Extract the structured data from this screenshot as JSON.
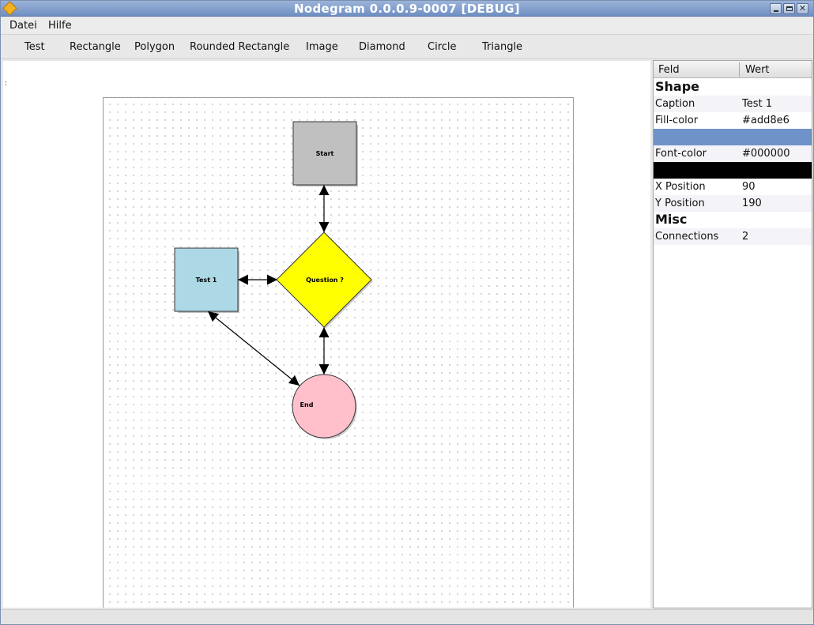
{
  "window": {
    "title": "Nodegram 0.0.0.9-0007 [DEBUG]",
    "close_glyph": "✕"
  },
  "menu": {
    "items": [
      "Datei",
      "Hilfe"
    ]
  },
  "toolbar": {
    "items": [
      "Test",
      "Rectangle",
      "Polygon",
      "Rounded Rectangle",
      "Image",
      "Diamond",
      "Circle",
      "Triangle"
    ]
  },
  "canvas": {
    "marker": ":"
  },
  "diagram": {
    "nodes": [
      {
        "id": "start",
        "shape": "rectangle",
        "caption": "Start",
        "fill": "#c0c0c0"
      },
      {
        "id": "test1",
        "shape": "rectangle",
        "caption": "Test 1",
        "fill": "#add8e6"
      },
      {
        "id": "question",
        "shape": "diamond",
        "caption": "Question ?",
        "fill": "#ffff00"
      },
      {
        "id": "end",
        "shape": "circle",
        "caption": "End",
        "fill": "#ffc0cb"
      }
    ],
    "edges": [
      {
        "from": "start",
        "to": "question",
        "arrows": "both"
      },
      {
        "from": "test1",
        "to": "question",
        "arrows": "both"
      },
      {
        "from": "question",
        "to": "end",
        "arrows": "both"
      },
      {
        "from": "test1",
        "to": "end",
        "arrows": "both"
      }
    ]
  },
  "properties": {
    "col_field": "Feld",
    "col_value": "Wert",
    "section_shape": "Shape",
    "section_misc": "Misc",
    "caption": {
      "label": "Caption",
      "value": "Test 1"
    },
    "fill_color": {
      "label": "Fill-color",
      "value": "#add8e6",
      "swatch": "#6f92c8"
    },
    "font_color": {
      "label": "Font-color",
      "value": "#000000",
      "swatch": "#000000"
    },
    "x_position": {
      "label": "X Position",
      "value": "90"
    },
    "y_position": {
      "label": "Y Position",
      "value": "190"
    },
    "connections": {
      "label": "Connections",
      "value": "2"
    }
  }
}
